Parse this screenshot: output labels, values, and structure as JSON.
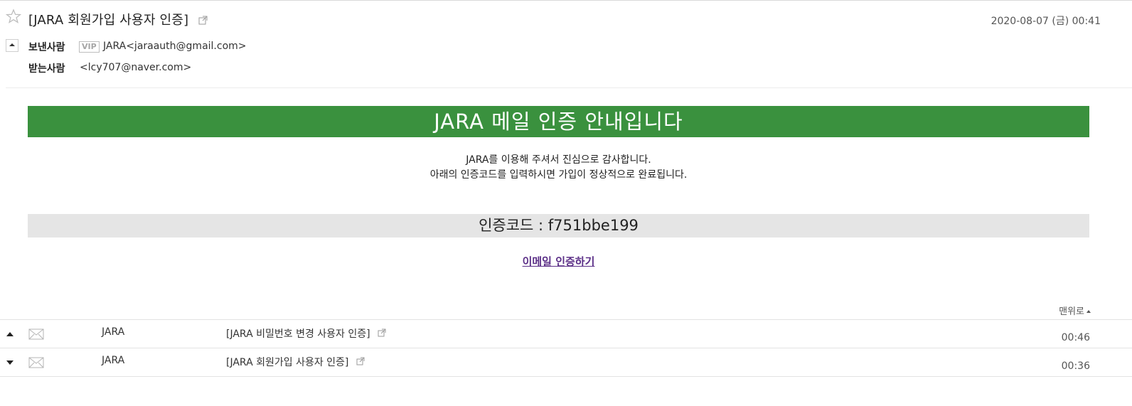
{
  "header": {
    "subject": "[JARA 회원가입 사용자 인증]",
    "date": "2020-08-07 (금) 00:41",
    "sender_label": "보낸사람",
    "vip_badge": "VIP",
    "sender": "JARA<jaraauth@gmail.com>",
    "receiver_label": "받는사람",
    "receiver": "<lcy707@naver.com>"
  },
  "body": {
    "banner_title": "JARA 메일 인증 안내입니다",
    "line1": "JARA를 이용해 주셔서 진심으로 감사합니다.",
    "line2": "아래의 인증코드를 입력하시면 가입이 정상적으로 완료됩니다.",
    "code_text": "인증코드 : f751bbe199",
    "verify_link": "이메일 인증하기"
  },
  "to_top": "맨위로",
  "mail_list": [
    {
      "direction": "up",
      "sender": "JARA",
      "subject": "[JARA 비밀번호 변경 사용자 인증]",
      "time": "00:46"
    },
    {
      "direction": "down",
      "sender": "JARA",
      "subject": "[JARA 회원가입 사용자 인증]",
      "time": "00:36"
    }
  ],
  "colors": {
    "banner": "#3a913e",
    "codebar": "#e5e5e5",
    "link": "#5b2f87"
  }
}
